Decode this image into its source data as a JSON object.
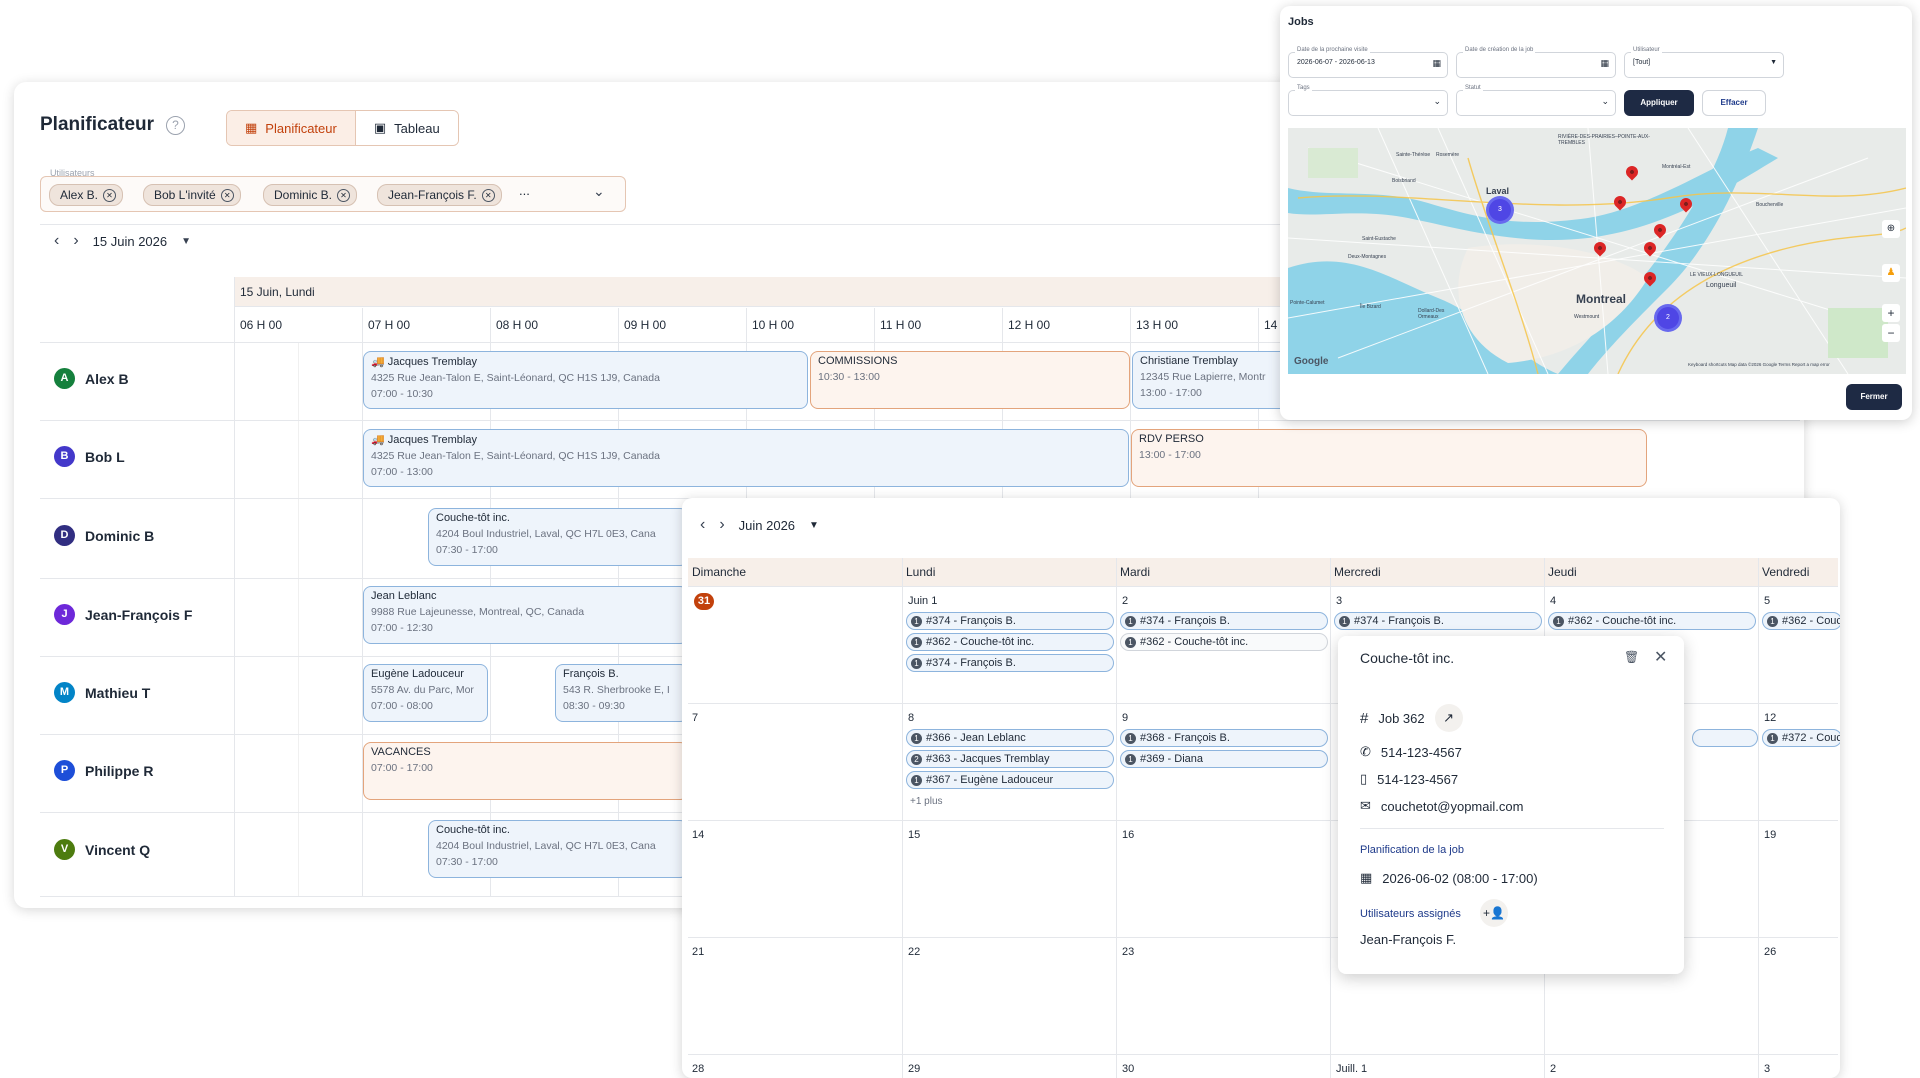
{
  "planner": {
    "title": "Planificateur",
    "help": "?",
    "tab_planner": "Planificateur",
    "tab_table": "Tableau",
    "users_label": "Utilisateurs",
    "chips": [
      "Alex B.",
      "Bob L'invité",
      "Dominic B.",
      "Jean-François F."
    ],
    "chips_more": "...",
    "date": "15 Juin 2026",
    "day_header": "15 Juin, Lundi",
    "hours": [
      "06 H 00",
      "07 H 00",
      "08 H 00",
      "09 H 00",
      "10 H 00",
      "11 H 00",
      "12 H 00",
      "13 H 00",
      "14"
    ],
    "rows": [
      {
        "initial": "A",
        "name": "Alex B",
        "color": "#15803d"
      },
      {
        "initial": "B",
        "name": "Bob L",
        "color": "#4338ca"
      },
      {
        "initial": "D",
        "name": "Dominic B",
        "color": "#312e81"
      },
      {
        "initial": "J",
        "name": "Jean-François F",
        "color": "#6d28d9"
      },
      {
        "initial": "M",
        "name": "Mathieu T",
        "color": "#0284c7"
      },
      {
        "initial": "P",
        "name": "Philippe R",
        "color": "#1d4ed8"
      },
      {
        "initial": "V",
        "name": "Vincent Q",
        "color": "#4d7c0f"
      }
    ],
    "events": [
      {
        "title": "Jacques Tremblay",
        "addr": "4325 Rue Jean-Talon E, Saint-Léonard, QC H1S 1J9, Canada",
        "time": "07:00 - 10:30"
      },
      {
        "title": "COMMISSIONS",
        "time": "10:30 - 13:00"
      },
      {
        "title": "Christiane Tremblay",
        "addr": "12345 Rue Lapierre, Montr",
        "time": "13:00 - 17:00"
      },
      {
        "title": "Jacques Tremblay",
        "addr": "4325 Rue Jean-Talon E, Saint-Léonard, QC H1S 1J9, Canada",
        "time": "07:00 - 13:00"
      },
      {
        "title": "RDV PERSO",
        "time": "13:00 - 17:00"
      },
      {
        "title": "Couche-tôt inc.",
        "addr": "4204 Boul Industriel, Laval, QC H7L 0E3, Cana",
        "time": "07:30 - 17:00"
      },
      {
        "title": "Jean Leblanc",
        "addr": "9988 Rue Lajeunesse, Montreal, QC, Canada",
        "time": "07:00 - 12:30"
      },
      {
        "title": "Eugène Ladouceur",
        "addr": "5578 Av. du Parc, Mor",
        "time": "07:00 - 08:00"
      },
      {
        "title": "François B.",
        "addr": "543 R. Sherbrooke E, I",
        "time": "08:30 - 09:30"
      },
      {
        "title": "VACANCES",
        "time": "07:00 - 17:00"
      },
      {
        "title": "Couche-tôt inc.",
        "addr": "4204 Boul Industriel, Laval, QC H7L 0E3, Cana",
        "time": "07:30 - 17:00"
      }
    ]
  },
  "month": {
    "label": "Juin 2026",
    "weekdays": [
      "Dimanche",
      "Lundi",
      "Mardi",
      "Mercredi",
      "Jeudi",
      "Vendredi"
    ],
    "day_numbers": {
      "r1": [
        "31",
        "Juin 1",
        "2",
        "3",
        "4",
        "5"
      ],
      "r2": [
        "7",
        "8",
        "9",
        "",
        "",
        "12"
      ],
      "r3": [
        "14",
        "15",
        "16",
        "",
        "",
        "19"
      ],
      "r4": [
        "21",
        "22",
        "23",
        "",
        "",
        "26"
      ],
      "r5": [
        "28",
        "29",
        "30",
        "Juill. 1",
        "2",
        "3"
      ]
    },
    "pills": {
      "mon1": [
        "#374 - François B.",
        "#362 - Couche-tôt inc.",
        "#374 - François B."
      ],
      "tue2": [
        "#374 - François B.",
        "#362 - Couche-tôt inc."
      ],
      "wed3": [
        "#374 - François B."
      ],
      "thu4": [
        "#362 - Couche-tôt inc."
      ],
      "fri5": [
        "#362 - Couc"
      ],
      "mon8": [
        "#366 - Jean Leblanc",
        "#363 - Jacques Tremblay",
        "#367 - Eugène Ladouceur"
      ],
      "tue9": [
        "#368 - François B.",
        "#369 - Diana"
      ],
      "fri12": [
        "#372 - Couc"
      ]
    },
    "pill_badges": {
      "one": "1",
      "two": "2"
    },
    "more_label": "+1 plus"
  },
  "popover": {
    "title": "Couche-tôt inc.",
    "job": "Job 362",
    "phone": "514-123-4567",
    "mobile": "514-123-4567",
    "email": "couchetot@yopmail.com",
    "planning_label": "Planification de la job",
    "planning_value": "2026-06-02  (08:00 - 17:00)",
    "assigned_label": "Utilisateurs assignés",
    "assigned_user": "Jean-François F."
  },
  "jobs": {
    "title": "Jobs",
    "next_visit_label": "Date de la prochaine visite",
    "next_visit_value": "2026-06-07 - 2026-06-13",
    "created_label": "Date de création de la job",
    "user_label": "Utilisateur",
    "user_value": "[Tout]",
    "tags_label": "Tags",
    "status_label": "Statut",
    "apply": "Appliquer",
    "clear": "Effacer",
    "close": "Fermer",
    "map_places": [
      "Laval",
      "Montreal",
      "Longueuil",
      "LE VIEUX-LONGUEUIL",
      "RIVIÈRE-DES-PRAIRIES–POINTE-AUX-TREMBLES",
      "Sainte-Thérèse",
      "Rosemère",
      "Boisbriand",
      "Boucherville",
      "Saint-Eustache",
      "Deux-Montagnes",
      "Pointe-Calumet",
      "Westmount",
      "Île Bizard",
      "Dollard-Des Ormeaux",
      "Montréal-Est"
    ],
    "clusters": [
      "3",
      "2"
    ],
    "map_logo": "Google",
    "map_footer": "Keyboard shortcuts   Map data ©2026 Google   Terms   Report a map error"
  }
}
